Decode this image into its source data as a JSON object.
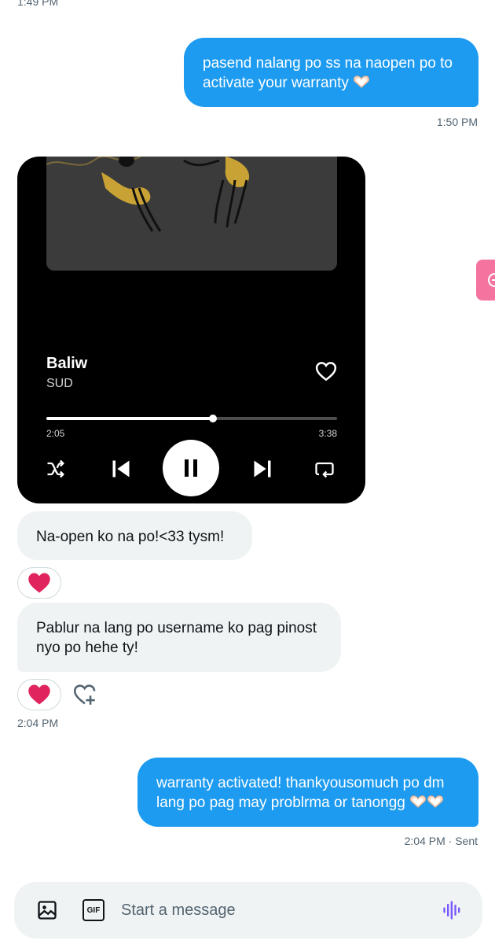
{
  "conversation": {
    "top_time": "1:49 PM",
    "messages": [
      {
        "direction": "outgoing",
        "text": "pasend nalang po ss na naopen po to activate your warranty",
        "emoji": "heart-hands",
        "time": "1:50 PM"
      },
      {
        "direction": "incoming",
        "type": "music-card",
        "track": {
          "title": "Baliw",
          "artist": "SUD",
          "elapsed": "2:05",
          "total": "3:38",
          "progress_fraction": 0.574
        }
      },
      {
        "direction": "incoming",
        "text": "Na-open ko na po!<33 tysm!",
        "reaction": "red-heart"
      },
      {
        "direction": "incoming",
        "text": "Pablur na lang po username ko pag pinost nyo po hehe ty!",
        "reaction": "red-heart",
        "time": "2:04 PM"
      },
      {
        "direction": "outgoing",
        "text": "warranty activated! thankyousomuch po dm lang po pag may problrma or tanongg",
        "emoji": "heart-hands-x2",
        "time": "2:04 PM · Sent"
      }
    ]
  },
  "composer": {
    "placeholder": "Start a message",
    "gif_label": "GIF"
  },
  "colors": {
    "outgoing_bubble": "#1d9bf0",
    "incoming_bubble": "#eff3f4",
    "secondary_text": "#536471",
    "heart_red": "#e0245e",
    "voice_icon": "#7856ff",
    "side_tab": "#f4739f"
  },
  "icons": [
    "image-icon",
    "gif-icon",
    "voice-icon",
    "heart-outline-icon",
    "shuffle-icon",
    "skip-previous-icon",
    "pause-icon",
    "skip-next-icon",
    "repeat-icon",
    "add-reaction-icon",
    "red-heart-icon",
    "heart-hands-emoji"
  ]
}
